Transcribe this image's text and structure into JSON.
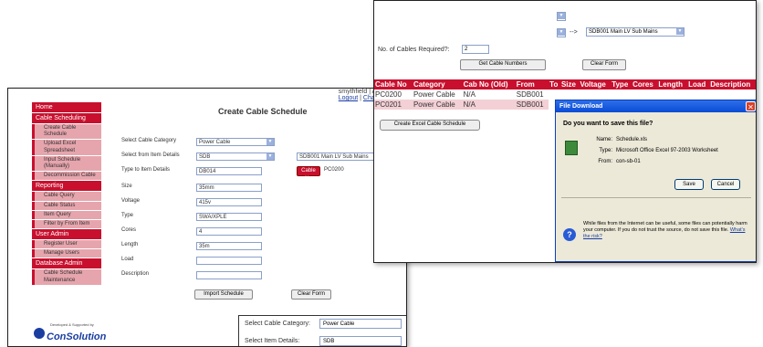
{
  "back_window": {
    "top_links": {
      "user": "smythfield | Administ",
      "logout": "Logout",
      "sep": "|",
      "change": "Change Passw"
    },
    "title": "Create Cable Schedule",
    "sidebar": [
      {
        "type": "head",
        "label": "Home"
      },
      {
        "type": "head",
        "label": "Cable Scheduling"
      },
      {
        "type": "item",
        "label": "Create Cable Schedule"
      },
      {
        "type": "item",
        "label": "Upload Excel Spreadsheet"
      },
      {
        "type": "item",
        "label": "Input Schedule (Manually)"
      },
      {
        "type": "item",
        "label": "Decommission Cable"
      },
      {
        "type": "head",
        "label": "Reporting"
      },
      {
        "type": "item",
        "label": "Cable Query"
      },
      {
        "type": "item",
        "label": "Cable Status"
      },
      {
        "type": "item",
        "label": "Item Query"
      },
      {
        "type": "item",
        "label": "Filter by From Item"
      },
      {
        "type": "head",
        "label": "User Admin"
      },
      {
        "type": "item",
        "label": "Register User"
      },
      {
        "type": "item",
        "label": "Manage Users"
      },
      {
        "type": "head",
        "label": "Database Admin"
      },
      {
        "type": "item",
        "label": "Cable Schedule Maintenance"
      }
    ],
    "form": {
      "category_label": "Select Cable Category",
      "category_value": "Power Cable",
      "from_label": "Select from Item Details",
      "from_value": "SDB",
      "to_value": "SDB001 Main LV Sub Mains",
      "to_label": "Type to Item Details",
      "to_input": "DB014",
      "cable_no_btn": "Cable No",
      "cable_no_val": "PC0200",
      "size_label": "Size",
      "size_val": "35mm",
      "voltage_label": "Voltage",
      "voltage_val": "415v",
      "type_label": "Type",
      "type_val": "SWA/XPLE",
      "cores_label": "Cores",
      "cores_val": "4",
      "length_label": "Length",
      "length_val": "35m",
      "load_label": "Load",
      "load_val": "",
      "desc_label": "Description",
      "desc_val": "",
      "import_btn": "Import Schedule",
      "clear_btn": "Clear Form"
    },
    "logo": {
      "small": "Developed & Supported by",
      "text": "ConSolution"
    },
    "inset": {
      "cat_label": "Select Cable Category:",
      "cat_value": "Power Cable",
      "item_label": "Select Item Details:",
      "item_value": "SDB"
    }
  },
  "front_window": {
    "arrow": "-->",
    "to_select": "SDB001 Main LV Sub Mains",
    "cables_label": "No. of Cables Required?:",
    "cables_value": "2",
    "get_btn": "Get Cable Numbers",
    "clear_btn": "Clear Form",
    "columns": [
      "Cable No",
      "Category",
      "Cab No (Old)",
      "From",
      "To",
      "Size",
      "Voltage",
      "Type",
      "Cores",
      "Length",
      "Load",
      "Description"
    ],
    "rows": [
      [
        "PC0200",
        "Power Cable",
        "N/A",
        "SDB001"
      ],
      [
        "PC0201",
        "Power Cable",
        "N/A",
        "SDB001"
      ]
    ],
    "excel_btn": "Create Excel Cable Schedule",
    "dialog": {
      "title": "File Download",
      "question": "Do you want to save this file?",
      "name_k": "Name:",
      "name_v": "Schedule.xls",
      "type_k": "Type:",
      "type_v": "Microsoft Office Excel 97-2003 Worksheet",
      "from_k": "From:",
      "from_v": "con-sb-01",
      "save": "Save",
      "cancel": "Cancel",
      "warning": "While files from the Internet can be useful, some files can potentially harm your computer. If you do not trust the source, do not save this file.",
      "risk_link": "What's the risk?"
    }
  }
}
